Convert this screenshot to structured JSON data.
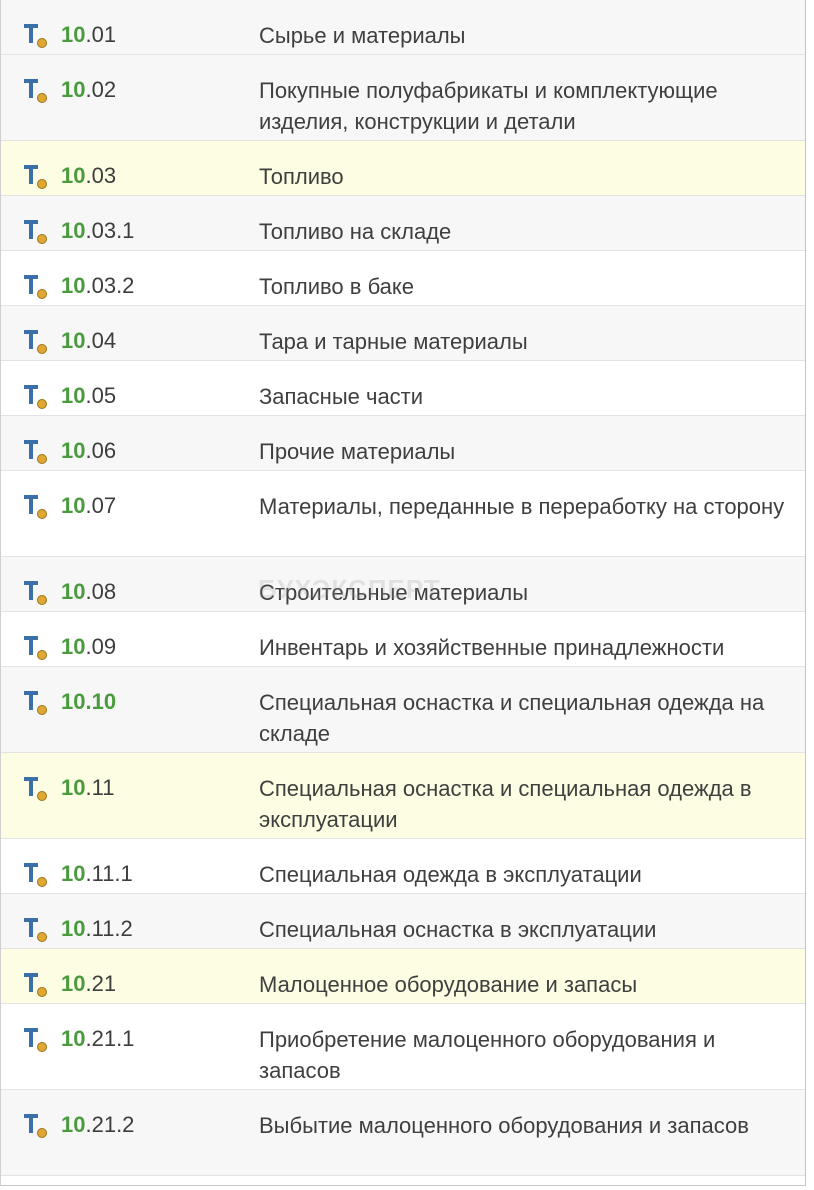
{
  "accounts": [
    {
      "major": "10",
      "minor": ".01",
      "name": "Сырье и материалы",
      "bg": "alt",
      "lines": 1
    },
    {
      "major": "10",
      "minor": ".02",
      "name": "Покупные полуфабрикаты и комплектующие изделия, конструкции и детали",
      "bg": "alt",
      "lines": 2
    },
    {
      "major": "10",
      "minor": ".03",
      "name": "Топливо",
      "bg": "hl",
      "lines": 1
    },
    {
      "major": "10",
      "minor": ".03.1",
      "name": "Топливо на складе",
      "bg": "alt",
      "lines": 1
    },
    {
      "major": "10",
      "minor": ".03.2",
      "name": "Топливо в баке",
      "bg": "plain",
      "lines": 1
    },
    {
      "major": "10",
      "minor": ".04",
      "name": "Тара и тарные материалы",
      "bg": "alt",
      "lines": 1
    },
    {
      "major": "10",
      "minor": ".05",
      "name": "Запасные части",
      "bg": "plain",
      "lines": 1
    },
    {
      "major": "10",
      "minor": ".06",
      "name": "Прочие материалы",
      "bg": "alt",
      "lines": 1
    },
    {
      "major": "10",
      "minor": ".07",
      "name": "Материалы, переданные в переработку на сторону",
      "bg": "plain",
      "lines": 2
    },
    {
      "major": "10",
      "minor": ".08",
      "name": "Строительные материалы",
      "bg": "alt",
      "lines": 1
    },
    {
      "major": "10",
      "minor": ".09",
      "name": "Инвентарь и хозяйственные принадлежности",
      "bg": "plain",
      "lines": 1
    },
    {
      "major": "10",
      "minor": ".10",
      "name": "Специальная оснастка и специальная одежда на складе",
      "bg": "alt",
      "lines": 2,
      "all_green": true
    },
    {
      "major": "10",
      "minor": ".11",
      "name": "Специальная оснастка и специальная одежда в эксплуатации",
      "bg": "hl",
      "lines": 2
    },
    {
      "major": "10",
      "minor": ".11.1",
      "name": "Специальная одежда в эксплуатации",
      "bg": "plain",
      "lines": 1
    },
    {
      "major": "10",
      "minor": ".11.2",
      "name": "Специальная оснастка в эксплуатации",
      "bg": "alt",
      "lines": 1
    },
    {
      "major": "10",
      "minor": ".21",
      "name": "Малоценное оборудование и запасы",
      "bg": "hl",
      "lines": 1
    },
    {
      "major": "10",
      "minor": ".21.1",
      "name": "Приобретение малоценного оборудования и запасов",
      "bg": "plain",
      "lines": 2
    },
    {
      "major": "10",
      "minor": ".21.2",
      "name": "Выбытие малоценного оборудования и запасов",
      "bg": "alt",
      "lines": 2
    }
  ],
  "watermark": "БУХЭКСПЕРТ",
  "icon": {
    "name": "account-type-icon",
    "letter_color": "#3a6fa8",
    "dot_color": "#e0a833"
  },
  "colors": {
    "code_major": "#4a9a3e",
    "highlight_row": "#fdfde3",
    "alt_row": "#f7f7f7"
  }
}
